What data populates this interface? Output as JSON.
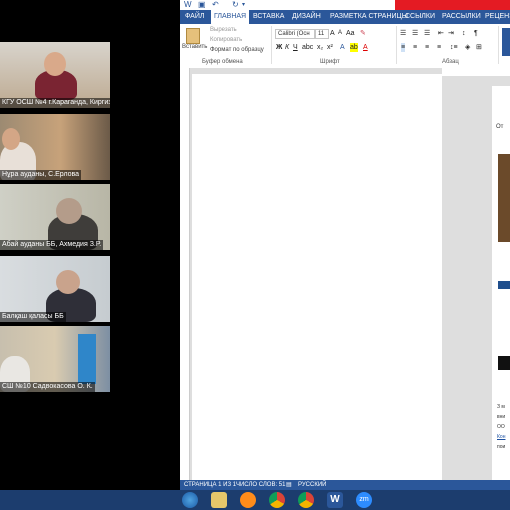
{
  "zoom": {
    "participants": [
      {
        "name": "КГУ ОСШ №4 г.Караганда, Киргизбаева..."
      },
      {
        "name": "Нұра ауданы, С.Ерлова"
      },
      {
        "name": "Абай ауданы ББ, Ахмедия З.Р."
      },
      {
        "name": "Балқаш қаласы ББ"
      },
      {
        "name": "СШ №10  Садвокасова О. К."
      }
    ]
  },
  "word": {
    "tabs": [
      "ФАЙЛ",
      "ГЛАВНАЯ",
      "ВСТАВКА",
      "ДИЗАЙН",
      "РАЗМЕТКА СТРАНИЦЫ",
      "ССЫЛКИ",
      "РАССЫЛКИ",
      "РЕЦЕНЗИ"
    ],
    "clipboard": {
      "paste": "Вставить",
      "cut": "Вырезать",
      "copy": "Копировать",
      "format_painter": "Формат по образцу",
      "label": "Буфер обмена"
    },
    "font": {
      "family": "Calibri (Осн",
      "size": "11",
      "label": "Шрифт",
      "bold": "Ж",
      "italic": "К",
      "underline": "Ч"
    },
    "paragraph": {
      "label": "Абзац"
    },
    "document": {
      "snippet_top": "От",
      "snippet_bottom": [
        "З м",
        "вни",
        "ОО",
        "Кон",
        "пои"
      ]
    },
    "status": {
      "page": "СТРАНИЦА 1 ИЗ 1",
      "words": "ЧИСЛО СЛОВ: 51",
      "language": "РУССКИЙ"
    }
  },
  "taskbar": {
    "icons": [
      "start-icon",
      "explorer-icon",
      "media-icon",
      "chrome-icon",
      "chrome2-icon",
      "word-icon",
      "zoom-icon"
    ],
    "zoom_label": "zm"
  }
}
